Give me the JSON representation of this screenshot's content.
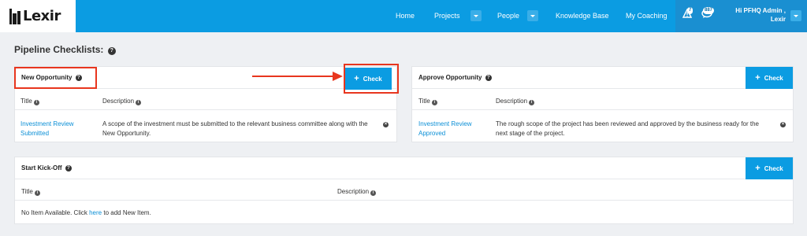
{
  "brand": {
    "name": "Lexir"
  },
  "nav": {
    "items": [
      "Home",
      "Projects",
      "People",
      "Knowledge Base",
      "My Coaching"
    ],
    "alerts_count": "7",
    "messages_count": "887",
    "greeting_line1": "Hi PFHQ Admin ,",
    "greeting_line2": "Lexir"
  },
  "page": {
    "title": "Pipeline Checklists:"
  },
  "check_label": "Check",
  "columns": {
    "title": "Title",
    "description": "Description"
  },
  "panels": {
    "new_opportunity": {
      "title": "New Opportunity",
      "row_title": "Investment Review Submitted",
      "row_desc": "A scope of the investment must be submitted to the relevant business committee along with the New Opportunity."
    },
    "approve_opportunity": {
      "title": "Approve Opportunity",
      "row_title": "Investment Review Approved",
      "row_desc": "The rough scope of the project has been reviewed and approved by the business ready for the next stage of the project."
    },
    "start_kickoff": {
      "title": "Start Kick-Off",
      "empty_prefix": "No Item Available. Click ",
      "empty_link": "here",
      "empty_suffix": " to add New Item."
    }
  },
  "colors": {
    "primary": "#0b9ce2",
    "highlight": "#e8361e",
    "link": "#0b8fd6"
  },
  "icons": [
    "help-icon",
    "info-icon",
    "remove-icon",
    "plus-icon",
    "alert-icon",
    "messages-icon",
    "chevron-down-icon"
  ]
}
